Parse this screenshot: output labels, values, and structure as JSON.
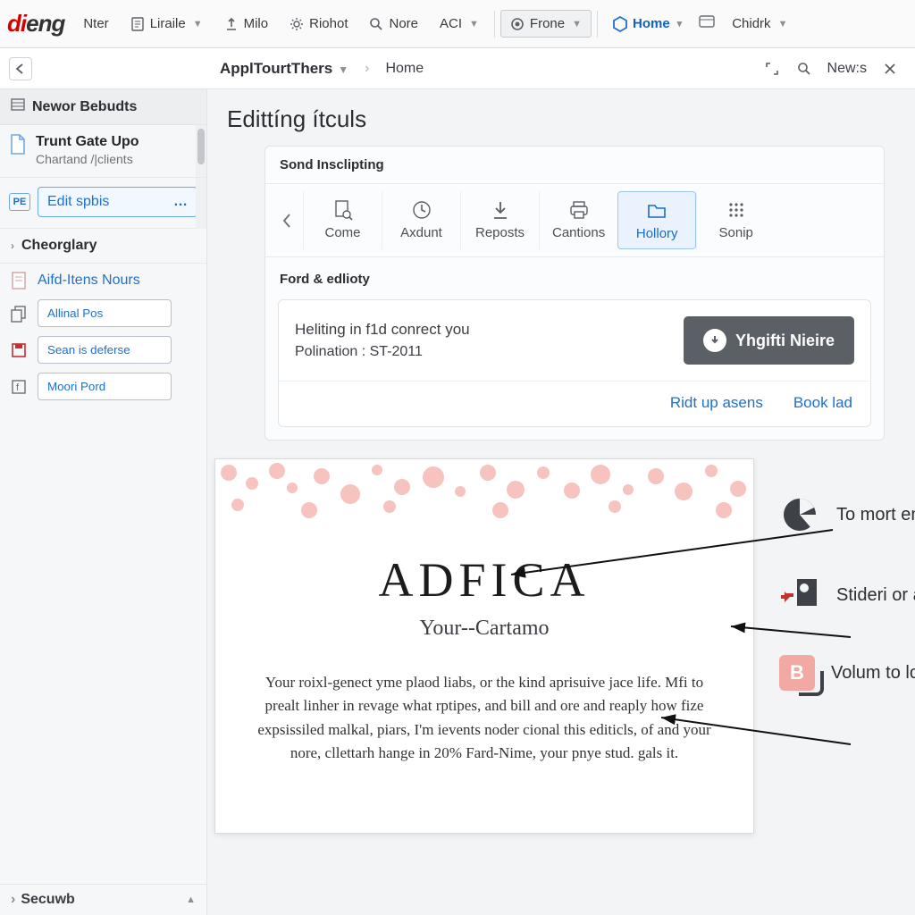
{
  "menubar": {
    "logo_left": "di",
    "logo_right": "eng",
    "items": [
      {
        "label": "Nter",
        "icon": null,
        "dropdown": false
      },
      {
        "label": "Liraile",
        "icon": "doc-icon",
        "dropdown": true
      },
      {
        "label": "Milo",
        "icon": "upload-icon",
        "dropdown": false
      },
      {
        "label": "Riohot",
        "icon": "gear-icon",
        "dropdown": false
      },
      {
        "label": "Nore",
        "icon": "search-icon",
        "dropdown": false
      },
      {
        "label": "ACI",
        "icon": null,
        "dropdown": true
      },
      {
        "label": "Frone",
        "icon": "target-icon",
        "dropdown": true,
        "framed": true
      },
      {
        "label": "Home",
        "icon": "hex-icon",
        "dropdown": false,
        "blue": true
      },
      {
        "label": "Chidrk",
        "icon": null,
        "dropdown": true
      }
    ]
  },
  "subheader": {
    "crumb_title": "ApplTourtThers",
    "crumb_link": "Home",
    "news_label": "New:s"
  },
  "sidebar": {
    "header": "Newor Bebudts",
    "project": {
      "title": "Trunt Gate Upo",
      "subtitle": "Chartand /|clients"
    },
    "chip_badge": "PE",
    "chip_label": "Edit spbis",
    "section": "Cheorglary",
    "items": [
      {
        "label": "Aifd-Itens Nours",
        "kind": "link"
      },
      {
        "label": "Allinal Pos",
        "kind": "button"
      },
      {
        "label": "Sean is deferse",
        "kind": "button"
      },
      {
        "label": "Moori Pord",
        "kind": "button"
      }
    ],
    "footer": "Secuwb"
  },
  "main": {
    "page_title": "Edittíng ítculs",
    "panel_head": "Sond Insclipting",
    "toolbar": [
      {
        "label": "Come",
        "icon": "page-search-icon"
      },
      {
        "label": "Axdunt",
        "icon": "clock-icon"
      },
      {
        "label": "Reposts",
        "icon": "download-icon"
      },
      {
        "label": "Cantions",
        "icon": "print-icon"
      },
      {
        "label": "Hollory",
        "icon": "folder-icon",
        "active": true
      },
      {
        "label": "Sonip",
        "icon": "grid-icon"
      }
    ],
    "subsection_title": "Ford & edlioty",
    "card": {
      "line1": "Heliting in f1d conrect you",
      "line2": "Polination : ST-2011",
      "button_label": "Yhgifti Nieire",
      "link1": "Ridt up asens",
      "link2": "Book lad"
    }
  },
  "preview": {
    "title": "ADFICA",
    "subtitle": "Your--Cartamo",
    "body": "Your roixl-genect yme plaod liabs, or the kind aprisuive jace life. Mfi to prealt linher in revage what rptipes, and bill and ore and reaply how fize expsissiled malkal, piars, I'm ievents noder cional this editicls, of and your nore, cllettarh hange in 20% Fard-Nime, your pnye stud. gals it."
  },
  "callouts": [
    {
      "label": "To mort ensostshing",
      "icon": "pie-icon"
    },
    {
      "label": "Stideri or aftion adtarres",
      "icon": "tools-icon"
    },
    {
      "label": "Volum to loum labe!",
      "icon": "badge-B"
    }
  ]
}
